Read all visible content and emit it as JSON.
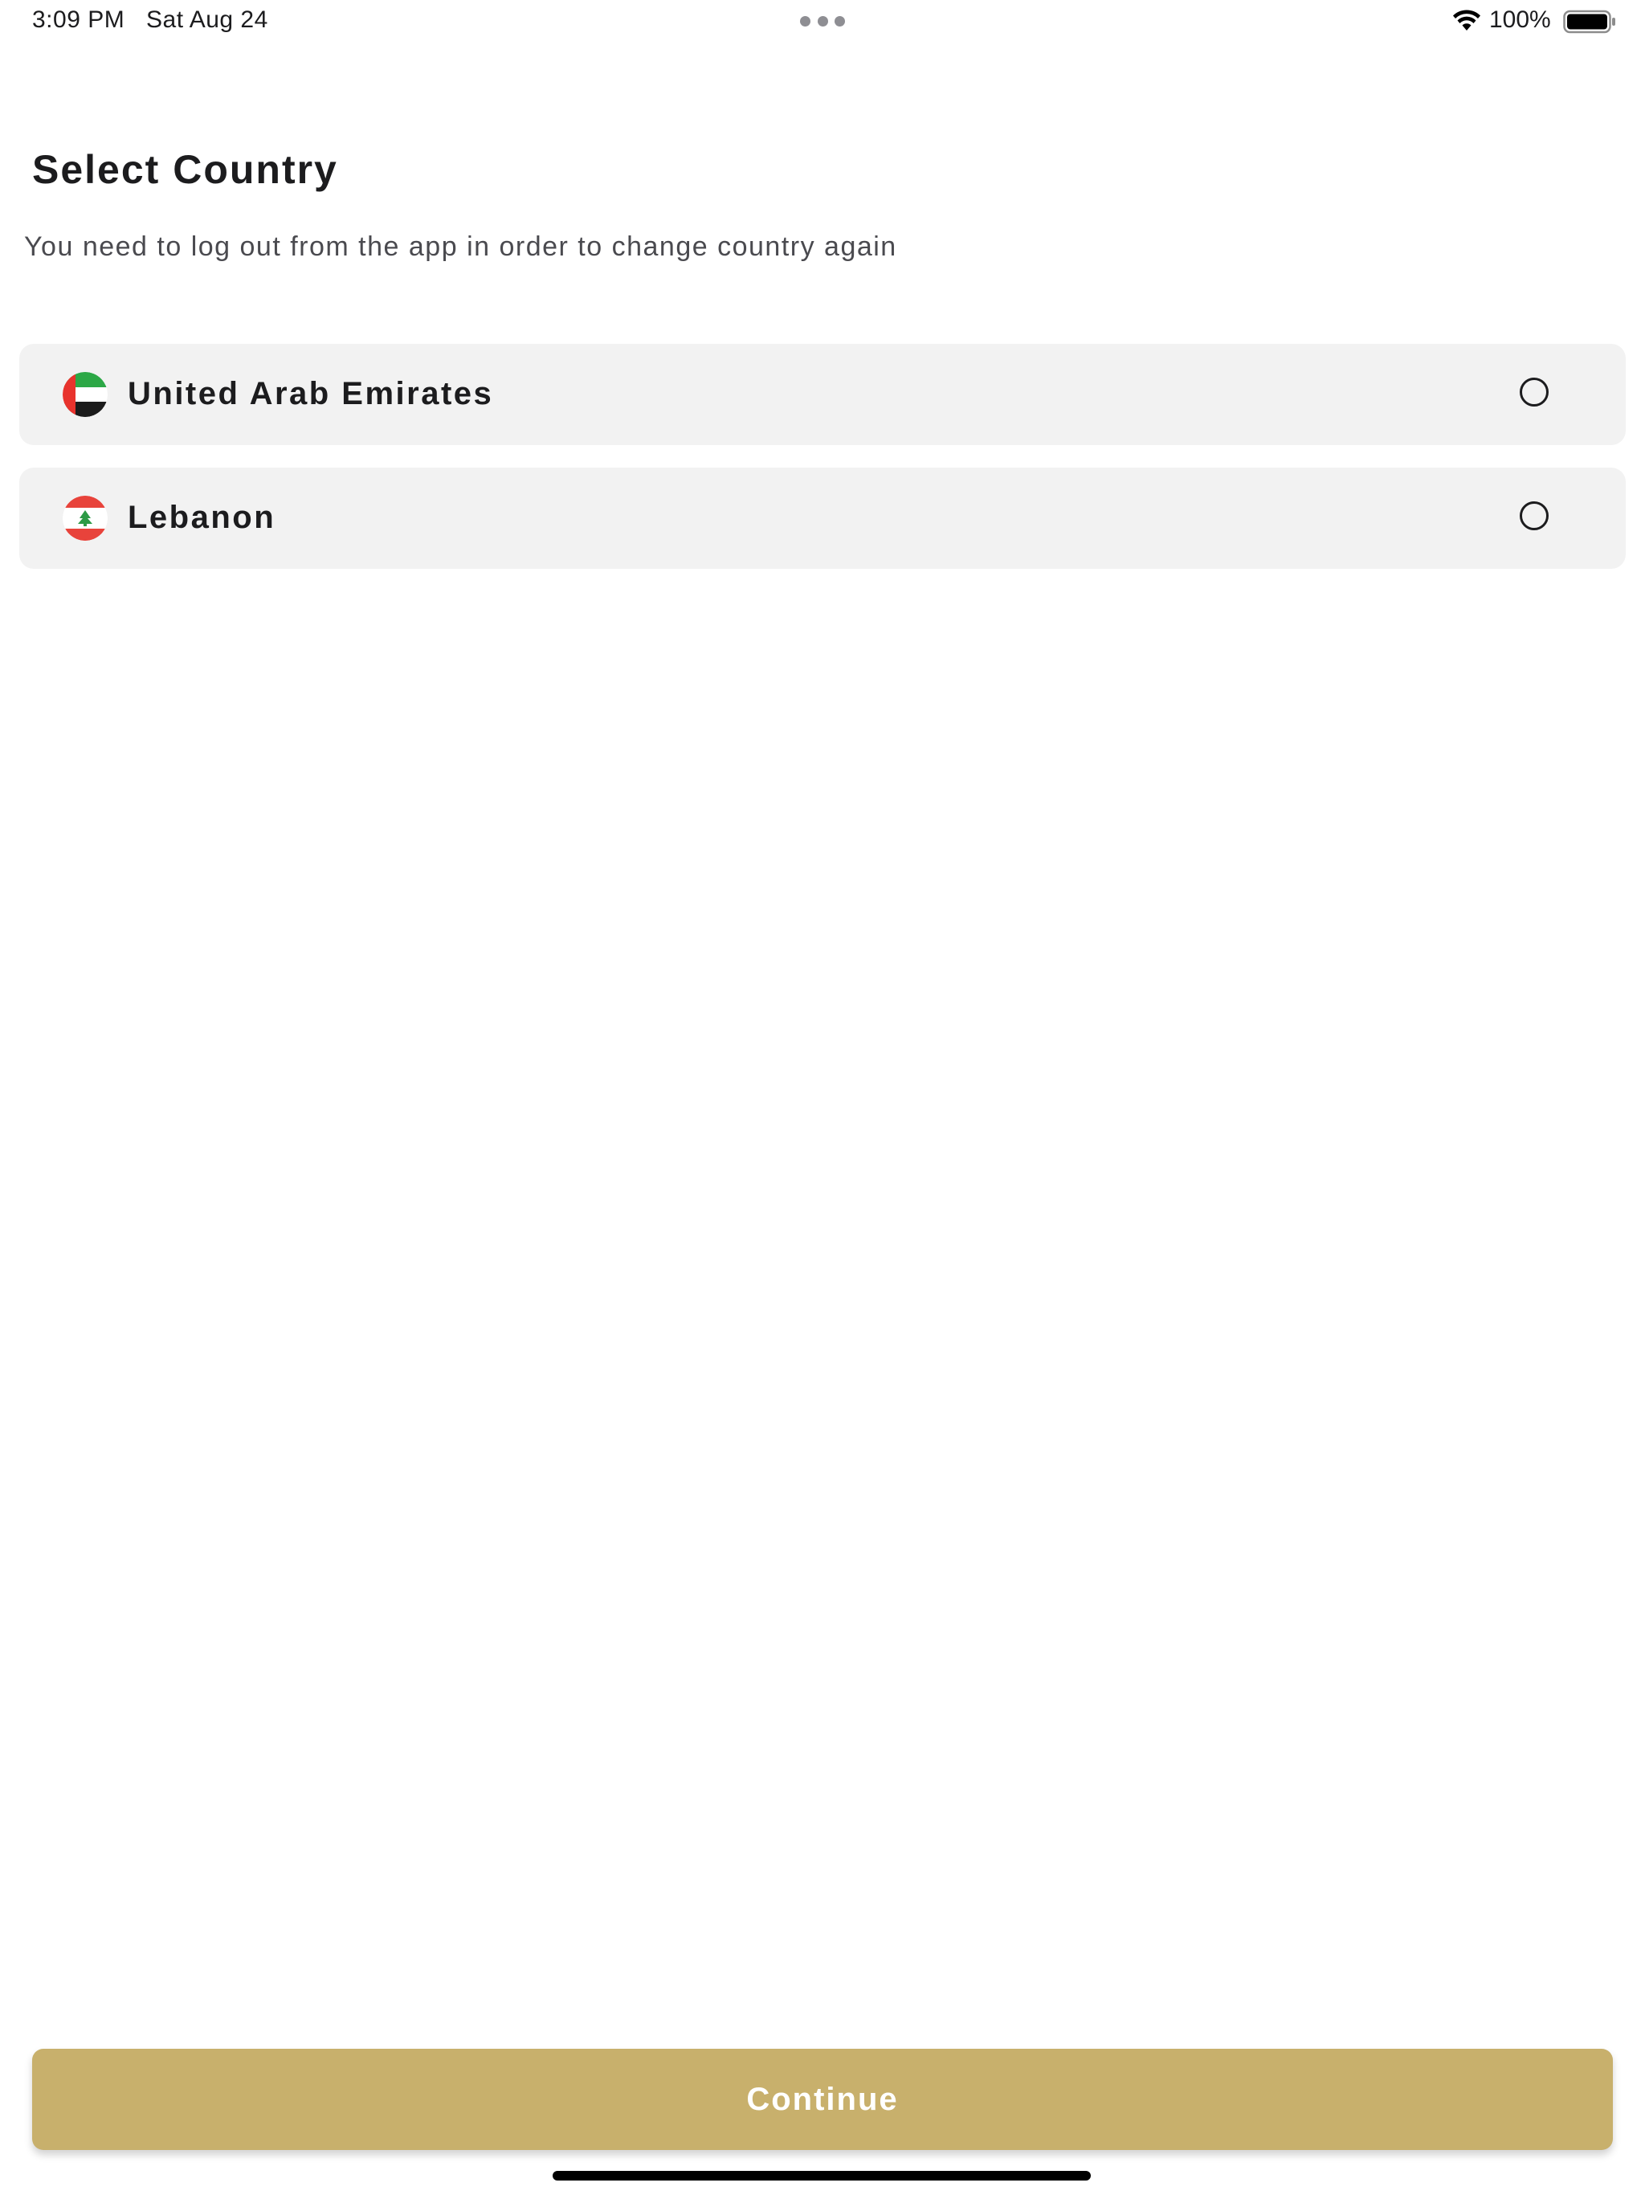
{
  "status_bar": {
    "time": "3:09 PM",
    "date": "Sat Aug 24",
    "battery": "100%",
    "icons": [
      "wifi-icon",
      "battery-icon"
    ]
  },
  "header": {
    "title": "Select Country",
    "subtitle": "You need to log out from the app in order to change country again"
  },
  "countries": [
    {
      "name": "United Arab Emirates",
      "flag_icon": "uae-flag-icon",
      "selected": false
    },
    {
      "name": "Lebanon",
      "flag_icon": "lebanon-flag-icon",
      "selected": false
    }
  ],
  "actions": {
    "continue_label": "Continue"
  },
  "colors": {
    "accent": "#c8b06c",
    "item_background": "#f2f2f2",
    "text": "#1c1c1e"
  }
}
